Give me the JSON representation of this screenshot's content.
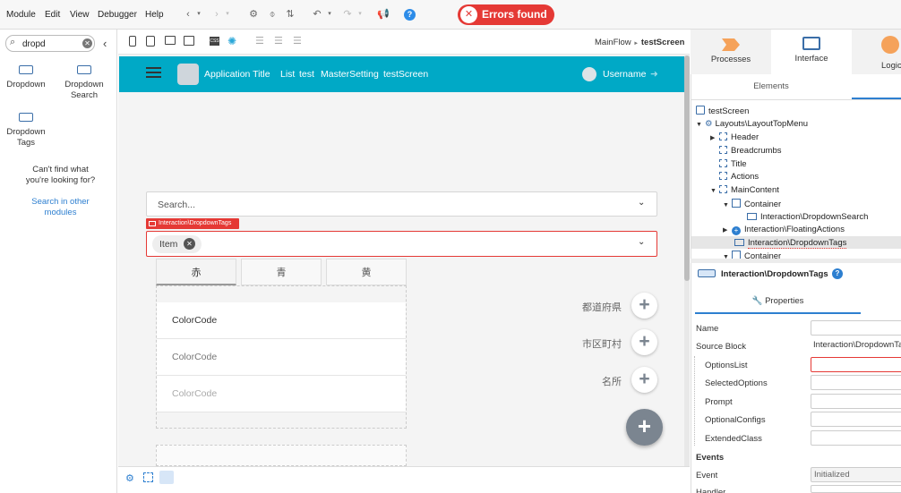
{
  "menu": [
    "Module",
    "Edit",
    "View",
    "Debugger",
    "Help"
  ],
  "errors": {
    "label": "Errors found"
  },
  "left": {
    "search_value": "dropd",
    "widgets": [
      {
        "label1": "Dropdown",
        "label2": ""
      },
      {
        "label1": "Dropdown",
        "label2": "Search"
      },
      {
        "label1": "Dropdown",
        "label2": "Tags"
      }
    ],
    "not_found1": "Can't find what",
    "not_found2": "you're looking for?",
    "search_other1": "Search in other",
    "search_other2": "modules"
  },
  "breadcrumb": {
    "flow": "MainFlow",
    "arrow": "►",
    "screen": "testScreen"
  },
  "app": {
    "title": "Application Title",
    "nav": [
      "List",
      "test",
      "MasterSetting",
      "testScreen"
    ],
    "username": "Username"
  },
  "canvas": {
    "search_placeholder": "Search...",
    "tag_label": "Interaction\\DropdownTags",
    "chip": "Item",
    "tabs": [
      "赤",
      "青",
      "黄"
    ],
    "rows": [
      "ColorCode",
      "ColorCode",
      "ColorCode"
    ],
    "side_labels": [
      "都道府県",
      "市区町村",
      "名所"
    ]
  },
  "right": {
    "tabs": [
      "Processes",
      "Interface",
      "Logic"
    ],
    "elements_label": "Elements",
    "tree": [
      {
        "text": "testScreen"
      },
      {
        "text": "Layouts\\LayoutTopMenu"
      },
      {
        "text": "Header"
      },
      {
        "text": "Breadcrumbs"
      },
      {
        "text": "Title"
      },
      {
        "text": "Actions"
      },
      {
        "text": "MainContent"
      },
      {
        "text": "Container"
      },
      {
        "text": "Interaction\\DropdownSearch"
      },
      {
        "text": "Interaction\\FloatingActions"
      },
      {
        "text": "Interaction\\DropdownTags"
      },
      {
        "text": "Container"
      }
    ],
    "selected_title": "Interaction\\DropdownTags",
    "properties_label": "Properties",
    "props": [
      {
        "name": "Name",
        "value": ""
      },
      {
        "name": "Source Block",
        "value": "Interaction\\DropdownTags"
      },
      {
        "name": "OptionsList",
        "value": ""
      },
      {
        "name": "SelectedOptions",
        "value": ""
      },
      {
        "name": "Prompt",
        "value": ""
      },
      {
        "name": "OptionalConfigs",
        "value": ""
      },
      {
        "name": "ExtendedClass",
        "value": ""
      }
    ],
    "events_label": "Events",
    "event": {
      "name": "Event",
      "value": "Initialized"
    },
    "handler": "Handler"
  },
  "colors": {
    "accent": "#00a9c6",
    "error": "#e53935",
    "link": "#3b6ea8"
  }
}
